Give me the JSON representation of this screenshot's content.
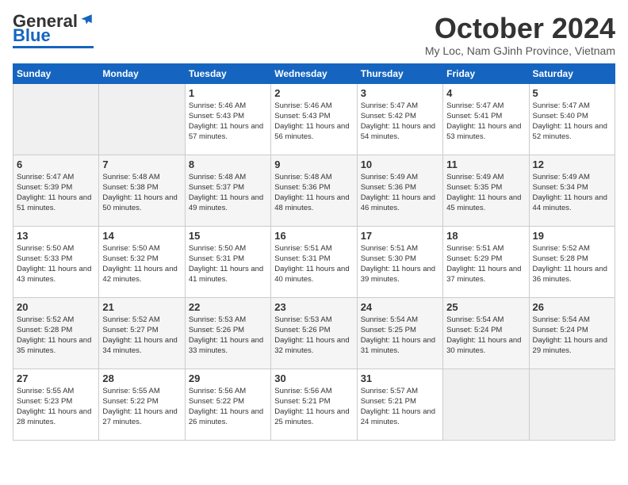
{
  "logo": {
    "general": "General",
    "blue": "Blue"
  },
  "header": {
    "title": "October 2024",
    "subtitle": "My Loc, Nam GJinh Province, Vietnam"
  },
  "weekdays": [
    "Sunday",
    "Monday",
    "Tuesday",
    "Wednesday",
    "Thursday",
    "Friday",
    "Saturday"
  ],
  "weeks": [
    [
      {
        "day": "",
        "sunrise": "",
        "sunset": "",
        "daylight": ""
      },
      {
        "day": "",
        "sunrise": "",
        "sunset": "",
        "daylight": ""
      },
      {
        "day": "1",
        "sunrise": "Sunrise: 5:46 AM",
        "sunset": "Sunset: 5:43 PM",
        "daylight": "Daylight: 11 hours and 57 minutes."
      },
      {
        "day": "2",
        "sunrise": "Sunrise: 5:46 AM",
        "sunset": "Sunset: 5:43 PM",
        "daylight": "Daylight: 11 hours and 56 minutes."
      },
      {
        "day": "3",
        "sunrise": "Sunrise: 5:47 AM",
        "sunset": "Sunset: 5:42 PM",
        "daylight": "Daylight: 11 hours and 54 minutes."
      },
      {
        "day": "4",
        "sunrise": "Sunrise: 5:47 AM",
        "sunset": "Sunset: 5:41 PM",
        "daylight": "Daylight: 11 hours and 53 minutes."
      },
      {
        "day": "5",
        "sunrise": "Sunrise: 5:47 AM",
        "sunset": "Sunset: 5:40 PM",
        "daylight": "Daylight: 11 hours and 52 minutes."
      }
    ],
    [
      {
        "day": "6",
        "sunrise": "Sunrise: 5:47 AM",
        "sunset": "Sunset: 5:39 PM",
        "daylight": "Daylight: 11 hours and 51 minutes."
      },
      {
        "day": "7",
        "sunrise": "Sunrise: 5:48 AM",
        "sunset": "Sunset: 5:38 PM",
        "daylight": "Daylight: 11 hours and 50 minutes."
      },
      {
        "day": "8",
        "sunrise": "Sunrise: 5:48 AM",
        "sunset": "Sunset: 5:37 PM",
        "daylight": "Daylight: 11 hours and 49 minutes."
      },
      {
        "day": "9",
        "sunrise": "Sunrise: 5:48 AM",
        "sunset": "Sunset: 5:36 PM",
        "daylight": "Daylight: 11 hours and 48 minutes."
      },
      {
        "day": "10",
        "sunrise": "Sunrise: 5:49 AM",
        "sunset": "Sunset: 5:36 PM",
        "daylight": "Daylight: 11 hours and 46 minutes."
      },
      {
        "day": "11",
        "sunrise": "Sunrise: 5:49 AM",
        "sunset": "Sunset: 5:35 PM",
        "daylight": "Daylight: 11 hours and 45 minutes."
      },
      {
        "day": "12",
        "sunrise": "Sunrise: 5:49 AM",
        "sunset": "Sunset: 5:34 PM",
        "daylight": "Daylight: 11 hours and 44 minutes."
      }
    ],
    [
      {
        "day": "13",
        "sunrise": "Sunrise: 5:50 AM",
        "sunset": "Sunset: 5:33 PM",
        "daylight": "Daylight: 11 hours and 43 minutes."
      },
      {
        "day": "14",
        "sunrise": "Sunrise: 5:50 AM",
        "sunset": "Sunset: 5:32 PM",
        "daylight": "Daylight: 11 hours and 42 minutes."
      },
      {
        "day": "15",
        "sunrise": "Sunrise: 5:50 AM",
        "sunset": "Sunset: 5:31 PM",
        "daylight": "Daylight: 11 hours and 41 minutes."
      },
      {
        "day": "16",
        "sunrise": "Sunrise: 5:51 AM",
        "sunset": "Sunset: 5:31 PM",
        "daylight": "Daylight: 11 hours and 40 minutes."
      },
      {
        "day": "17",
        "sunrise": "Sunrise: 5:51 AM",
        "sunset": "Sunset: 5:30 PM",
        "daylight": "Daylight: 11 hours and 39 minutes."
      },
      {
        "day": "18",
        "sunrise": "Sunrise: 5:51 AM",
        "sunset": "Sunset: 5:29 PM",
        "daylight": "Daylight: 11 hours and 37 minutes."
      },
      {
        "day": "19",
        "sunrise": "Sunrise: 5:52 AM",
        "sunset": "Sunset: 5:28 PM",
        "daylight": "Daylight: 11 hours and 36 minutes."
      }
    ],
    [
      {
        "day": "20",
        "sunrise": "Sunrise: 5:52 AM",
        "sunset": "Sunset: 5:28 PM",
        "daylight": "Daylight: 11 hours and 35 minutes."
      },
      {
        "day": "21",
        "sunrise": "Sunrise: 5:52 AM",
        "sunset": "Sunset: 5:27 PM",
        "daylight": "Daylight: 11 hours and 34 minutes."
      },
      {
        "day": "22",
        "sunrise": "Sunrise: 5:53 AM",
        "sunset": "Sunset: 5:26 PM",
        "daylight": "Daylight: 11 hours and 33 minutes."
      },
      {
        "day": "23",
        "sunrise": "Sunrise: 5:53 AM",
        "sunset": "Sunset: 5:26 PM",
        "daylight": "Daylight: 11 hours and 32 minutes."
      },
      {
        "day": "24",
        "sunrise": "Sunrise: 5:54 AM",
        "sunset": "Sunset: 5:25 PM",
        "daylight": "Daylight: 11 hours and 31 minutes."
      },
      {
        "day": "25",
        "sunrise": "Sunrise: 5:54 AM",
        "sunset": "Sunset: 5:24 PM",
        "daylight": "Daylight: 11 hours and 30 minutes."
      },
      {
        "day": "26",
        "sunrise": "Sunrise: 5:54 AM",
        "sunset": "Sunset: 5:24 PM",
        "daylight": "Daylight: 11 hours and 29 minutes."
      }
    ],
    [
      {
        "day": "27",
        "sunrise": "Sunrise: 5:55 AM",
        "sunset": "Sunset: 5:23 PM",
        "daylight": "Daylight: 11 hours and 28 minutes."
      },
      {
        "day": "28",
        "sunrise": "Sunrise: 5:55 AM",
        "sunset": "Sunset: 5:22 PM",
        "daylight": "Daylight: 11 hours and 27 minutes."
      },
      {
        "day": "29",
        "sunrise": "Sunrise: 5:56 AM",
        "sunset": "Sunset: 5:22 PM",
        "daylight": "Daylight: 11 hours and 26 minutes."
      },
      {
        "day": "30",
        "sunrise": "Sunrise: 5:56 AM",
        "sunset": "Sunset: 5:21 PM",
        "daylight": "Daylight: 11 hours and 25 minutes."
      },
      {
        "day": "31",
        "sunrise": "Sunrise: 5:57 AM",
        "sunset": "Sunset: 5:21 PM",
        "daylight": "Daylight: 11 hours and 24 minutes."
      },
      {
        "day": "",
        "sunrise": "",
        "sunset": "",
        "daylight": ""
      },
      {
        "day": "",
        "sunrise": "",
        "sunset": "",
        "daylight": ""
      }
    ]
  ]
}
